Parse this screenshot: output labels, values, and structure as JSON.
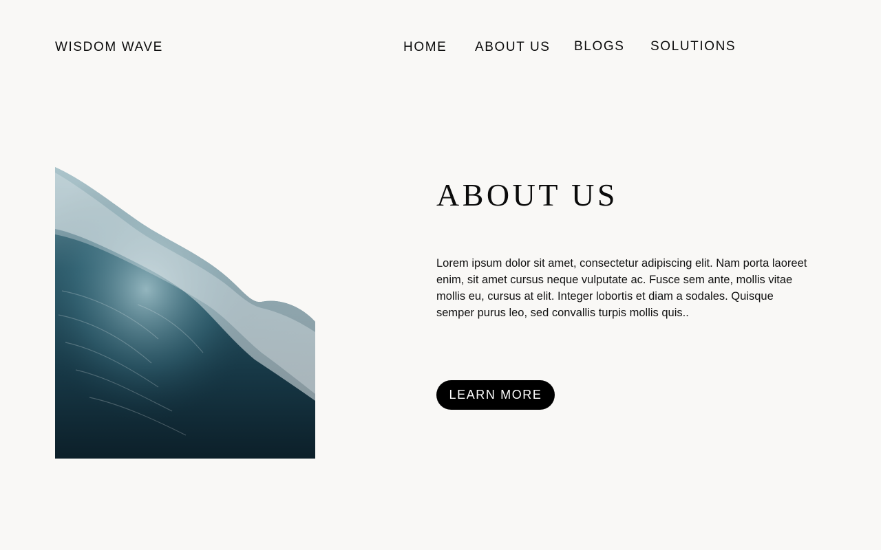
{
  "header": {
    "brand": "WISDOM WAVE",
    "nav": {
      "home": "HOME",
      "about": "ABOUT US",
      "blogs": "BLOGS",
      "solutions": "SOLUTIONS"
    }
  },
  "main": {
    "title": "ABOUT US",
    "body": "Lorem ipsum dolor sit amet, consectetur adipiscing elit. Nam porta laoreet enim, sit amet cursus neque vulputate ac. Fusce sem ante, mollis vitae mollis eu, cursus at elit. Integer lobortis et diam a sodales. Quisque semper purus leo, sed convallis turpis mollis quis..",
    "cta_label": "LEARN MORE"
  },
  "colors": {
    "background": "#f9f8f6",
    "text": "#0b0b0b",
    "button_bg": "#000000",
    "button_text": "#ffffff",
    "wave_deep": "#0f2a36",
    "wave_mid": "#2f5e6e",
    "wave_light": "#a9c6cf"
  },
  "image": {
    "subject": "ocean-wave-photo"
  }
}
